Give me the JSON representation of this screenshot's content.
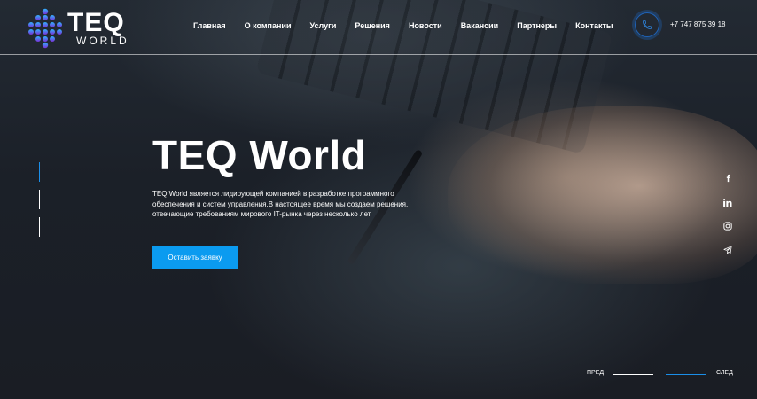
{
  "brand": {
    "title": "TEQ",
    "subtitle": "WORLD"
  },
  "nav": {
    "items": [
      {
        "label": "Главная"
      },
      {
        "label": "О компании"
      },
      {
        "label": "Услуги"
      },
      {
        "label": "Решения"
      },
      {
        "label": "Новости"
      },
      {
        "label": "Вакансии"
      },
      {
        "label": "Партнеры"
      },
      {
        "label": "Контакты"
      }
    ]
  },
  "contact": {
    "phone": "+7 747 875 39 18"
  },
  "hero": {
    "title": "TEQ World",
    "description": "TEQ World   является лидирующей компанией в разработке программного обеспечения и систем управления.В настоящее время мы создаем решения, отвечающие требованиям мирового IT-рынка через несколько лет.",
    "cta_label": "Оставить заявку"
  },
  "slider": {
    "prev_label": "ПРЕД",
    "next_label": "СЛЕД"
  },
  "socials": [
    "facebook-icon",
    "linkedin-icon",
    "instagram-icon",
    "telegram-icon"
  ],
  "colors": {
    "accent": "#0b9bf0",
    "logo_gradient_start": "#2fb4ff",
    "logo_gradient_end": "#7a2fd8"
  }
}
